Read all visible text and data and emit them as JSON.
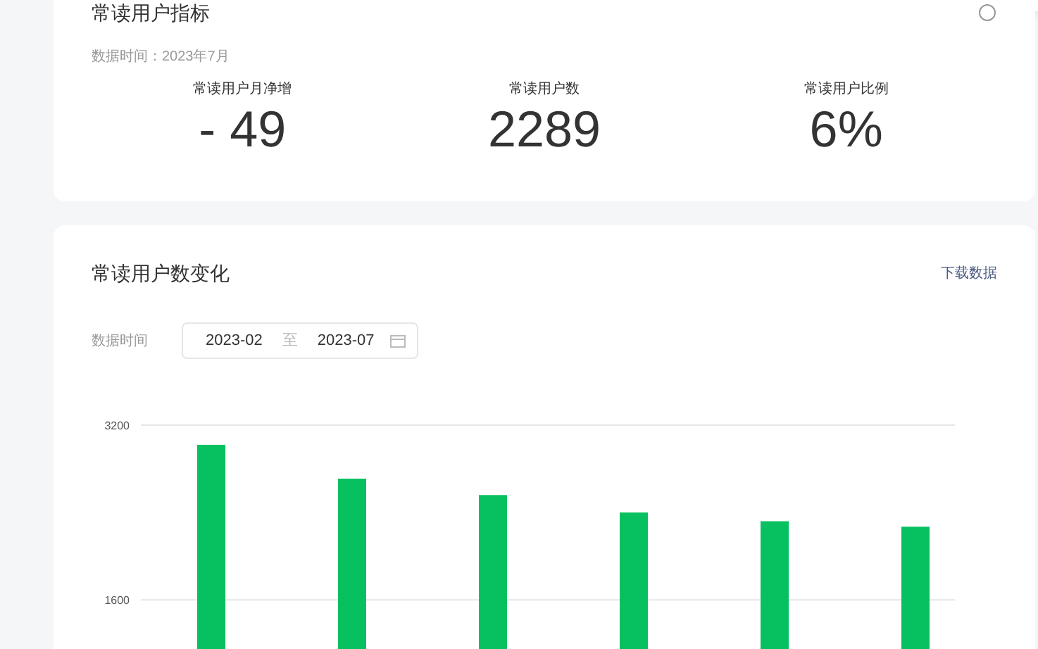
{
  "metrics_card": {
    "title": "常读用户指标",
    "data_time": "数据时间：2023年7月",
    "metrics": [
      {
        "label": "常读用户月净增",
        "value": "- 49"
      },
      {
        "label": "常读用户数",
        "value": "2289"
      },
      {
        "label": "常读用户比例",
        "value": "6%"
      }
    ]
  },
  "trend_card": {
    "title": "常读用户数变化",
    "download": "下载数据",
    "date_label": "数据时间",
    "date_range": {
      "start": "2023-02",
      "separator": "至",
      "end": "2023-07"
    },
    "chart_data": {
      "type": "bar",
      "ylim": [
        1150,
        3200
      ],
      "yticks": [
        1600,
        3200
      ],
      "series": [
        {
          "color": "#07c160",
          "values": [
            3020,
            2710,
            2560,
            2400,
            2320,
            2270
          ]
        }
      ]
    }
  }
}
